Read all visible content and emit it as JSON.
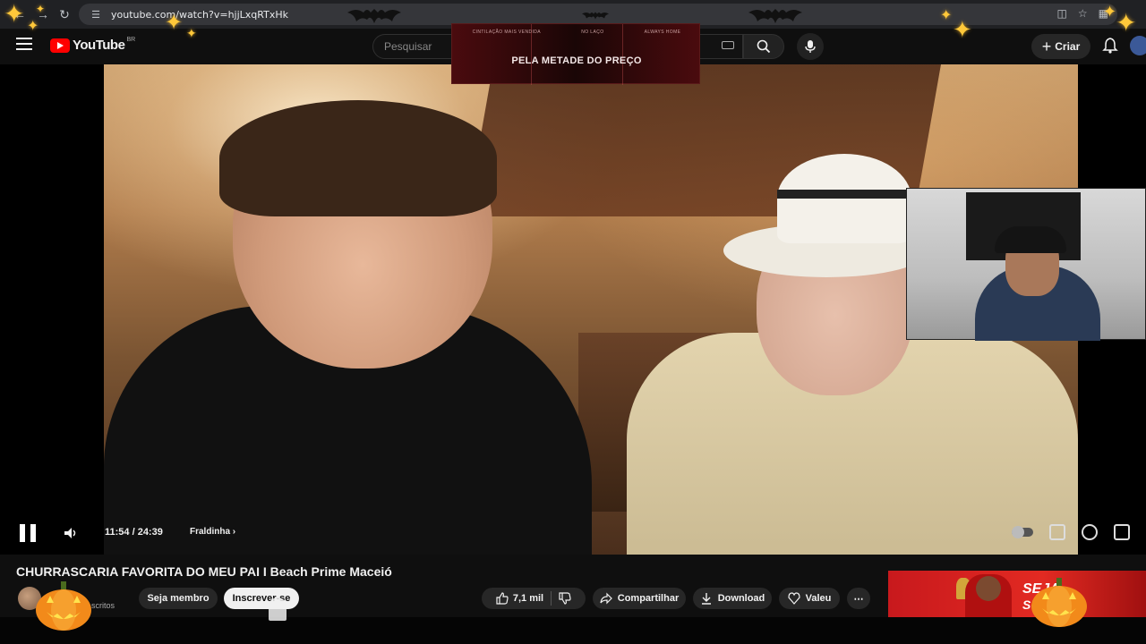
{
  "browser": {
    "url": "youtube.com/watch?v=hjjLxqRTxHk"
  },
  "header": {
    "logo_text": "YouTube",
    "country_code": "BR",
    "search_placeholder": "Pesquisar",
    "create_label": "Criar"
  },
  "ad_overlay": {
    "top_items": [
      "CINTILAÇÃO MAIS VENDIDA",
      "NO LAÇO",
      "ALWAYS HOME"
    ],
    "headline": "PELA METADE DO PREÇO"
  },
  "player": {
    "time": "11:54 / 24:39",
    "chapter": "Fraldinha",
    "progress_fraction": 0.4828,
    "loaded_fraction": 0.5138
  },
  "video": {
    "title": "CHURRASCARIA FAVORITA DO MEU PAI I Beach Prime Maceió",
    "subscribers_label": "scritos"
  },
  "actions": {
    "member_label": "Seja membro",
    "subscribe_label": "Inscrever-se",
    "like_count": "7,1 mil",
    "share_label": "Compartilhar",
    "download_label": "Download",
    "thanks_label": "Valeu"
  },
  "side_ad": {
    "brand_line1": "SEJA",
    "brand_line2": "SUP"
  },
  "colors": {
    "progress": "#ff0033",
    "youtube_red": "#ff0000",
    "sparkle": "#ffc83a",
    "pumpkin": "#f28a1a"
  }
}
